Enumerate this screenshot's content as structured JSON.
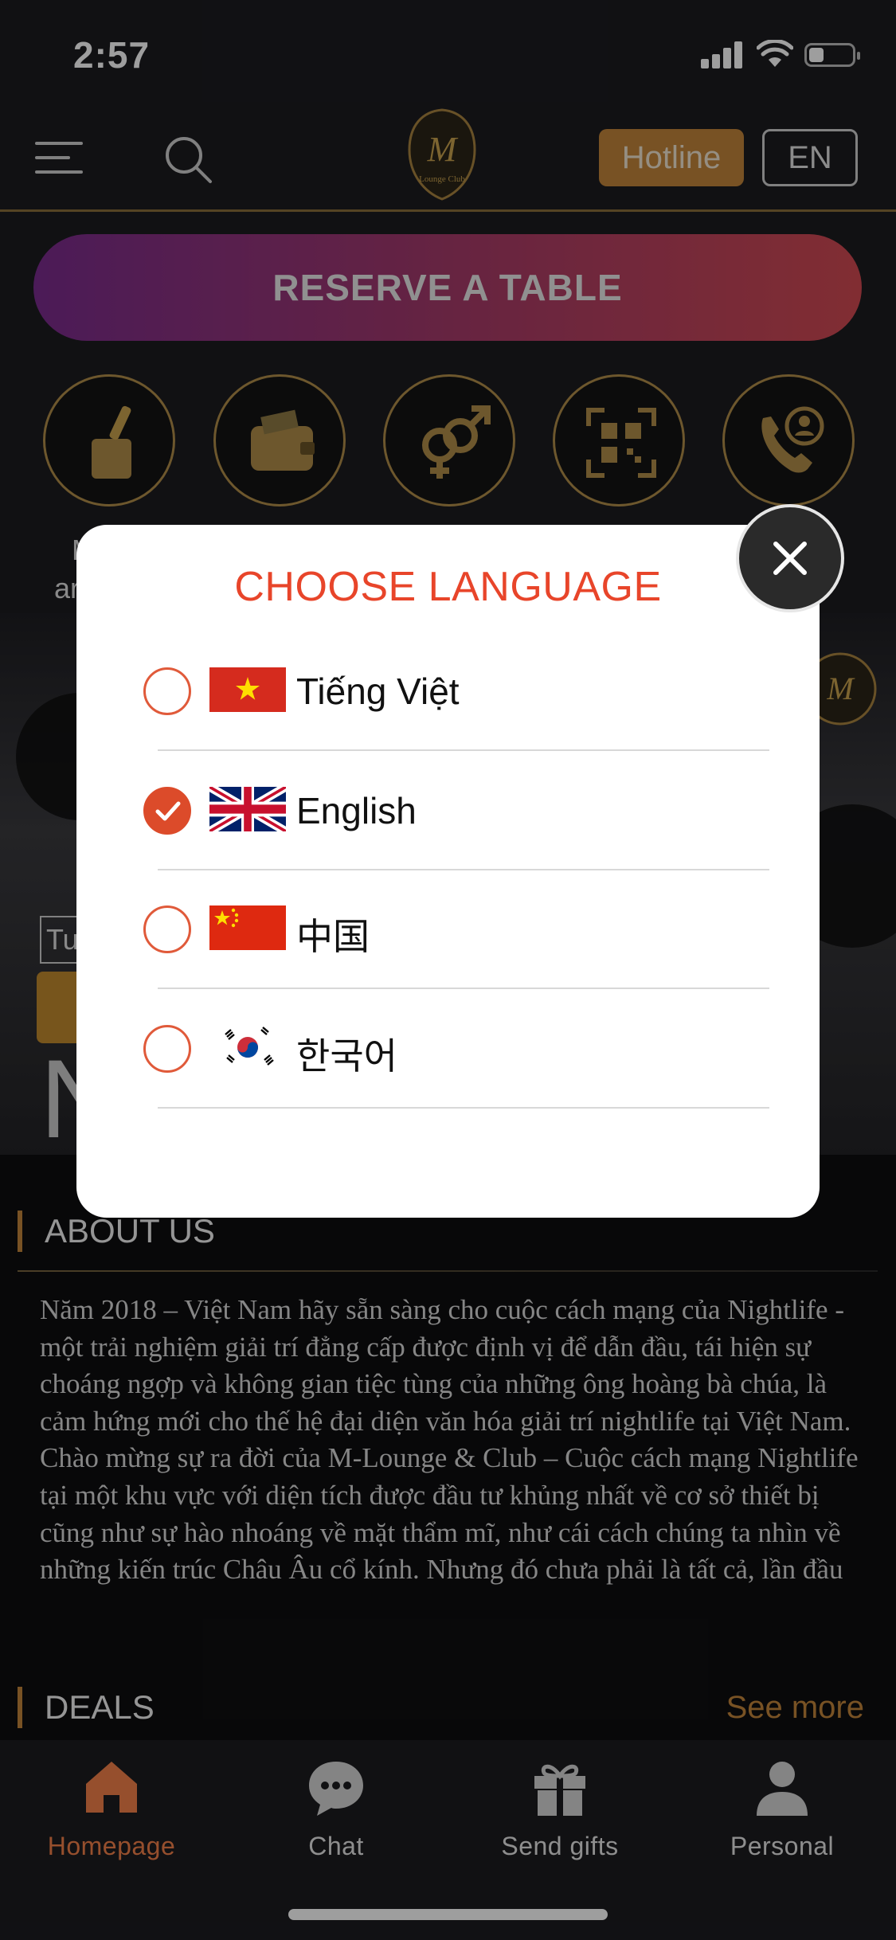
{
  "status_bar": {
    "time": "2:57",
    "battery_level": 0.35
  },
  "header": {
    "hotline_label": "Hotline",
    "language_code": "EN",
    "icons": [
      "menu-icon",
      "search-icon",
      "m-lounge-logo"
    ]
  },
  "reserve": {
    "label": "RESERVE A TABLE"
  },
  "features": {
    "icons": [
      "bottle-bucket-icon",
      "wallet-icon",
      "gender-icon",
      "qr-code-icon",
      "phone-support-icon"
    ],
    "visible_label_fragments": [
      "M",
      "ar",
      "r"
    ]
  },
  "banner": {
    "tag_text": "Tue",
    "big_text": "N"
  },
  "about": {
    "title": "ABOUT US",
    "text": "Năm 2018 – Việt Nam hãy sẵn sàng cho cuộc cách mạng của Nightlife - một trải nghiệm giải trí đẳng cấp được định vị để dẫn đầu, tái hiện sự choáng ngợp và không gian tiệc tùng của những ông hoàng bà chúa, là cảm hứng mới cho thế hệ đại diện văn hóa giải trí nightlife tại Việt Nam. Chào mừng sự ra đời của M-Lounge & Club – Cuộc cách mạng Nightlife tại một khu vực với diện tích được đầu tư khủng nhất về cơ sở thiết bị cũng như sự hào nhoáng về mặt thẩm mĩ, như cái cách chúng ta nhìn về những kiến trúc Châu Âu cổ kính. Nhưng đó chưa phải là tất cả, lần đầu tiên rào cản giữa cũ và mới sẽ được phá bỏ bởi"
  },
  "deals": {
    "title": "DEALS",
    "see_more": "See more"
  },
  "tabbar": {
    "items": [
      {
        "label": "Homepage",
        "icon": "home-icon",
        "active": true
      },
      {
        "label": "Chat",
        "icon": "chat-icon",
        "active": false
      },
      {
        "label": "Send gifts",
        "icon": "gift-icon",
        "active": false
      },
      {
        "label": "Personal",
        "icon": "person-icon",
        "active": false
      }
    ]
  },
  "modal": {
    "title": "CHOOSE LANGUAGE",
    "close_icon": "close-icon",
    "languages": [
      {
        "label": "Tiếng Việt",
        "flag": "vietnam-flag-icon",
        "selected": false
      },
      {
        "label": "English",
        "flag": "uk-flag-icon",
        "selected": true
      },
      {
        "label": "中国",
        "flag": "china-flag-icon",
        "selected": false
      },
      {
        "label": "한국어",
        "flag": "korea-flag-icon",
        "selected": false
      }
    ]
  },
  "colors": {
    "accent_gold": "#c2853a",
    "modal_title": "#e8452a",
    "radio_checked": "#dc4b2a",
    "active_tab": "#f2804a"
  }
}
